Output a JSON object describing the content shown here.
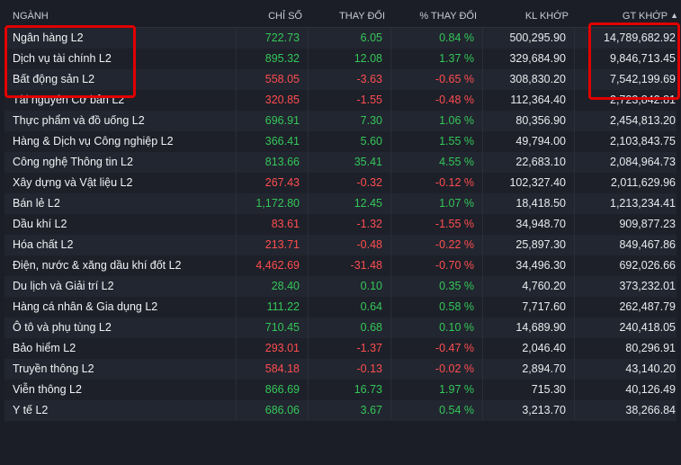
{
  "headers": {
    "sector": "NGÀNH",
    "index": "CHỈ SỐ",
    "change": "THAY ĐỔI",
    "pct_change": "% THAY ĐỔI",
    "volume": "KL KHỚP",
    "value": "GT KHỚP"
  },
  "colors": {
    "up": "#34c759",
    "down": "#ff4d4f",
    "highlight": "#e10000"
  },
  "rows": [
    {
      "sector": "Ngân hàng L2",
      "index": "722.73",
      "change": "6.05",
      "pct": "0.84 %",
      "volume": "500,295.90",
      "value": "14,789,682.92",
      "trend": "up"
    },
    {
      "sector": "Dịch vụ tài chính L2",
      "index": "895.32",
      "change": "12.08",
      "pct": "1.37 %",
      "volume": "329,684.90",
      "value": "9,846,713.45",
      "trend": "up"
    },
    {
      "sector": "Bất động sản L2",
      "index": "558.05",
      "change": "-3.63",
      "pct": "-0.65 %",
      "volume": "308,830.20",
      "value": "7,542,199.69",
      "trend": "down"
    },
    {
      "sector": "Tài nguyên Cơ bản L2",
      "index": "320.85",
      "change": "-1.55",
      "pct": "-0.48 %",
      "volume": "112,364.40",
      "value": "2,723,842.81",
      "trend": "down"
    },
    {
      "sector": "Thực phẩm và đồ uống L2",
      "index": "696.91",
      "change": "7.30",
      "pct": "1.06 %",
      "volume": "80,356.90",
      "value": "2,454,813.20",
      "trend": "up"
    },
    {
      "sector": "Hàng & Dịch vụ Công nghiệp L2",
      "index": "366.41",
      "change": "5.60",
      "pct": "1.55 %",
      "volume": "49,794.00",
      "value": "2,103,843.75",
      "trend": "up"
    },
    {
      "sector": "Công nghệ Thông tin L2",
      "index": "813.66",
      "change": "35.41",
      "pct": "4.55 %",
      "volume": "22,683.10",
      "value": "2,084,964.73",
      "trend": "up"
    },
    {
      "sector": "Xây dựng và Vật liệu L2",
      "index": "267.43",
      "change": "-0.32",
      "pct": "-0.12 %",
      "volume": "102,327.40",
      "value": "2,011,629.96",
      "trend": "down"
    },
    {
      "sector": "Bán lẻ L2",
      "index": "1,172.80",
      "change": "12.45",
      "pct": "1.07 %",
      "volume": "18,418.50",
      "value": "1,213,234.41",
      "trend": "up"
    },
    {
      "sector": "Dầu khí L2",
      "index": "83.61",
      "change": "-1.32",
      "pct": "-1.55 %",
      "volume": "34,948.70",
      "value": "909,877.23",
      "trend": "down"
    },
    {
      "sector": "Hóa chất L2",
      "index": "213.71",
      "change": "-0.48",
      "pct": "-0.22 %",
      "volume": "25,897.30",
      "value": "849,467.86",
      "trend": "down"
    },
    {
      "sector": "Điện, nước & xăng dầu khí đốt L2",
      "index": "4,462.69",
      "change": "-31.48",
      "pct": "-0.70 %",
      "volume": "34,496.30",
      "value": "692,026.66",
      "trend": "down"
    },
    {
      "sector": "Du lịch và Giải trí L2",
      "index": "28.40",
      "change": "0.10",
      "pct": "0.35 %",
      "volume": "4,760.20",
      "value": "373,232.01",
      "trend": "up"
    },
    {
      "sector": "Hàng cá nhân & Gia dụng L2",
      "index": "111.22",
      "change": "0.64",
      "pct": "0.58 %",
      "volume": "7,717.60",
      "value": "262,487.79",
      "trend": "up"
    },
    {
      "sector": "Ô tô và phụ tùng L2",
      "index": "710.45",
      "change": "0.68",
      "pct": "0.10 %",
      "volume": "14,689.90",
      "value": "240,418.05",
      "trend": "up"
    },
    {
      "sector": "Bảo hiểm L2",
      "index": "293.01",
      "change": "-1.37",
      "pct": "-0.47 %",
      "volume": "2,046.40",
      "value": "80,296.91",
      "trend": "down"
    },
    {
      "sector": "Truyền thông L2",
      "index": "584.18",
      "change": "-0.13",
      "pct": "-0.02 %",
      "volume": "2,894.70",
      "value": "43,140.20",
      "trend": "down"
    },
    {
      "sector": "Viễn thông L2",
      "index": "866.69",
      "change": "16.73",
      "pct": "1.97 %",
      "volume": "715.30",
      "value": "40,126.49",
      "trend": "up"
    },
    {
      "sector": "Y tế L2",
      "index": "686.06",
      "change": "3.67",
      "pct": "0.54 %",
      "volume": "3,213.70",
      "value": "38,266.84",
      "trend": "up"
    }
  ]
}
